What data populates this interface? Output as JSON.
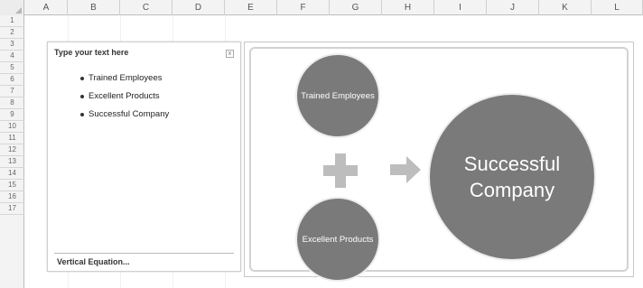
{
  "columns": [
    "A",
    "B",
    "C",
    "D",
    "E",
    "F",
    "G",
    "H",
    "I",
    "J",
    "K",
    "L"
  ],
  "rows": [
    "1",
    "2",
    "3",
    "4",
    "5",
    "6",
    "7",
    "8",
    "9",
    "10",
    "11",
    "12",
    "13",
    "14",
    "15",
    "16",
    "17"
  ],
  "text_pane": {
    "title": "Type your text here",
    "close_label": "x",
    "bullets": [
      "Trained Employees",
      "Excellent Products",
      "Successful Company"
    ],
    "footer": "Vertical Equation..."
  },
  "smartart": {
    "top_circle": "Trained Employees",
    "bottom_circle": "Excellent Products",
    "result_circle": "Successful Company",
    "plus_icon": "plus-icon",
    "arrow_icon": "arrow-right-icon",
    "colors": {
      "circle_fill": "#7a7a7a",
      "symbol_fill": "#bdbdbd"
    }
  }
}
